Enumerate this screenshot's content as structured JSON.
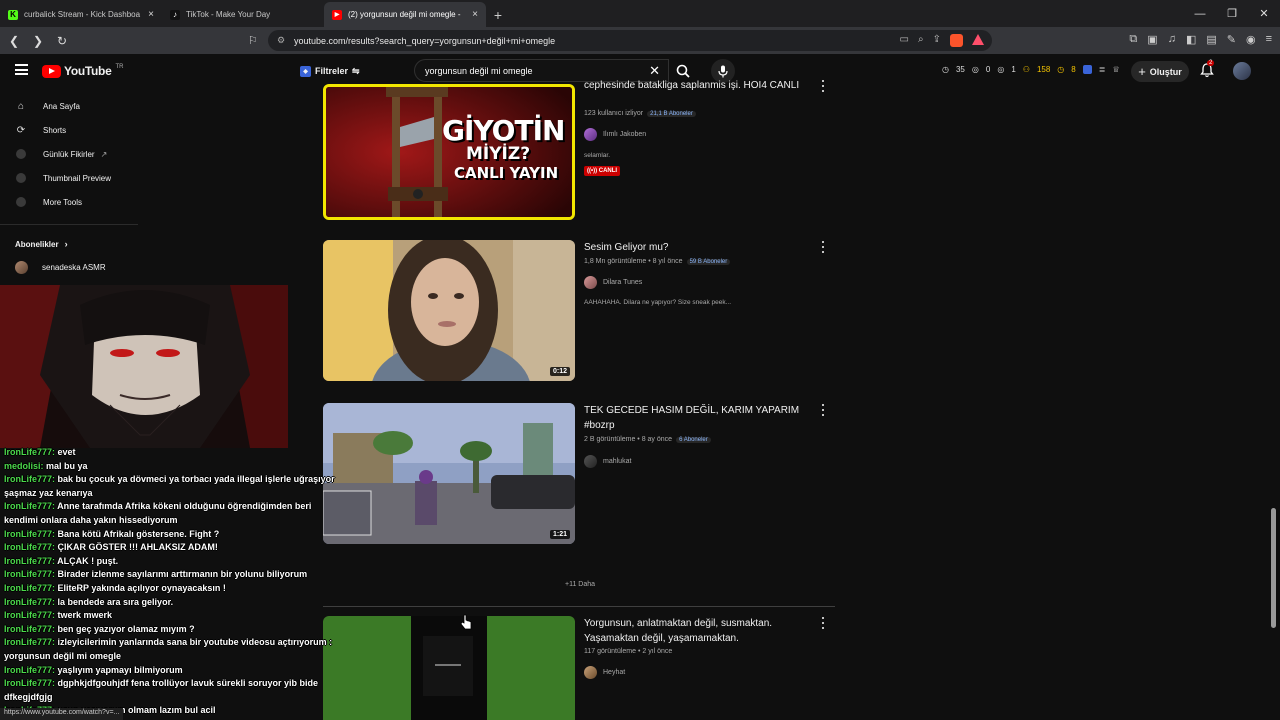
{
  "browser": {
    "tabs": [
      {
        "title": "curbalick Stream - Kick Dashboa",
        "color": "#53fc18",
        "glyph": "K"
      },
      {
        "title": "TikTok - Make Your Day",
        "color": "#111111",
        "glyph": "♪"
      },
      {
        "title": "(2) yorgunsun değil mi omegle -",
        "color": "#ff0000",
        "glyph": "▶"
      }
    ],
    "url": "youtube.com/results?search_query=yorgunsun+değil+mi+omegle",
    "status_url": "https://www.youtube.com/watch?v=..."
  },
  "header": {
    "logo_text": "YouTube",
    "logo_region": "TR",
    "filter_label": "Filtreler",
    "search_value": "yorgunsun değil mi omegle",
    "stats": {
      "a": "35",
      "b": "0",
      "c": "1",
      "d": "158",
      "e": "8"
    },
    "create_label": "Oluştur",
    "notif_count": "2"
  },
  "sidebar": {
    "items": [
      {
        "label": "Ana Sayfa",
        "icon": "home-icon"
      },
      {
        "label": "Shorts",
        "icon": "shorts-icon"
      },
      {
        "label": "Günlük Fikirler",
        "icon": "ideas-icon"
      },
      {
        "label": "Thumbnail Preview",
        "icon": "preview-icon"
      },
      {
        "label": "More Tools",
        "icon": "tools-icon"
      }
    ],
    "subs_heading": "Abonelikler",
    "subs": [
      {
        "label": "senadeska ASMR"
      }
    ]
  },
  "results": [
    {
      "title": "cephesinde batakliga saplanmis işi. HOI4 CANLI",
      "meta": "123 kullanıcı izliyor",
      "subs": "21,1 B Aboneler",
      "channel": "Ilımlı Jakoben",
      "desc": "selamlar.",
      "live": "CANLI",
      "thumb_text": [
        "GİYOTİN",
        "MİYİZ?",
        "CANLI YAYIN"
      ]
    },
    {
      "title": "Sesim Geliyor mu?",
      "meta": "1,8 Mn görüntüleme • 8 yıl önce",
      "subs": "59 B Aboneler",
      "channel": "Dilara Tunes",
      "desc": "AAHAHAHA. Dilara ne yapıyor? Size sneak peek...",
      "duration": "0:12"
    },
    {
      "title": "TEK GECEDE HASIM DEĞİL, KARIM YAPARIM #bozrp",
      "meta": "2 B görüntüleme • 8 ay önce",
      "subs": "6 Aboneler",
      "channel": "mahlukat",
      "duration": "1:21"
    },
    {
      "title": "Yorgunsun, anlatmaktan değil, susmaktan. Yaşamaktan değil, yaşamamaktan.",
      "meta": "117 görüntüleme • 2 yıl önce",
      "channel": "Heyhat"
    }
  ],
  "more_label": "+11 Daha",
  "chat": [
    {
      "user": "IronLife777:",
      "msg": " evet"
    },
    {
      "user": "medolisi:",
      "msg": " mal bu ya"
    },
    {
      "user": "IronLife777:",
      "msg": " bak bu çocuk ya dövmeci ya torbacı yada illegal işlerle uğraşıyor"
    },
    {
      "user": "",
      "msg": "şaşmaz yaz kenarıya"
    },
    {
      "user": "IronLife777:",
      "msg": " Anne tarafımda Afrika kökeni olduğunu öğrendiğimden beri"
    },
    {
      "user": "",
      "msg": "kendimi onlara daha yakın hissediyorum"
    },
    {
      "user": "IronLife777:",
      "msg": " Bana kötü Afrikalı göstersene. Fight ?"
    },
    {
      "user": "IronLife777:",
      "msg": " ÇIKAR GÖSTER !!! AHLAKSIZ ADAM!"
    },
    {
      "user": "IronLife777:",
      "msg": " ALÇAK ! puşt."
    },
    {
      "user": "IronLife777:",
      "msg": " Birader izlenme sayılarımı arttırmanın bir yolunu biliyorum"
    },
    {
      "user": "IronLife777:",
      "msg": " EliteRP yakında açılıyor oynayacaksın !"
    },
    {
      "user": "IronLife777:",
      "msg": " la bendede ara sıra geliyor."
    },
    {
      "user": "IronLife777:",
      "msg": " twerk mwerk"
    },
    {
      "user": "IronLife777:",
      "msg": " ben geç yazıyor olamaz mıyım ?"
    },
    {
      "user": "IronLife777:",
      "msg": " izleyicilerimin yanlarında sana bir youtube videosu açtırıyorum :"
    },
    {
      "user": "",
      "msg": "yorgunsun değil mi omegle"
    },
    {
      "user": "IronLife777:",
      "msg": " yaşlıyım yapmayı bilmiyorum"
    },
    {
      "user": "IronLife777:",
      "msg": " dgphkjdfgouhjdf fena trollüyor lavuk sürekli soruyor yib bide"
    },
    {
      "user": "",
      "msg": "dfkegjdfgjg"
    },
    {
      "user": "IronLife777:",
      "msg": " uzun yazıyorum olmam lazım bul acil"
    }
  ]
}
